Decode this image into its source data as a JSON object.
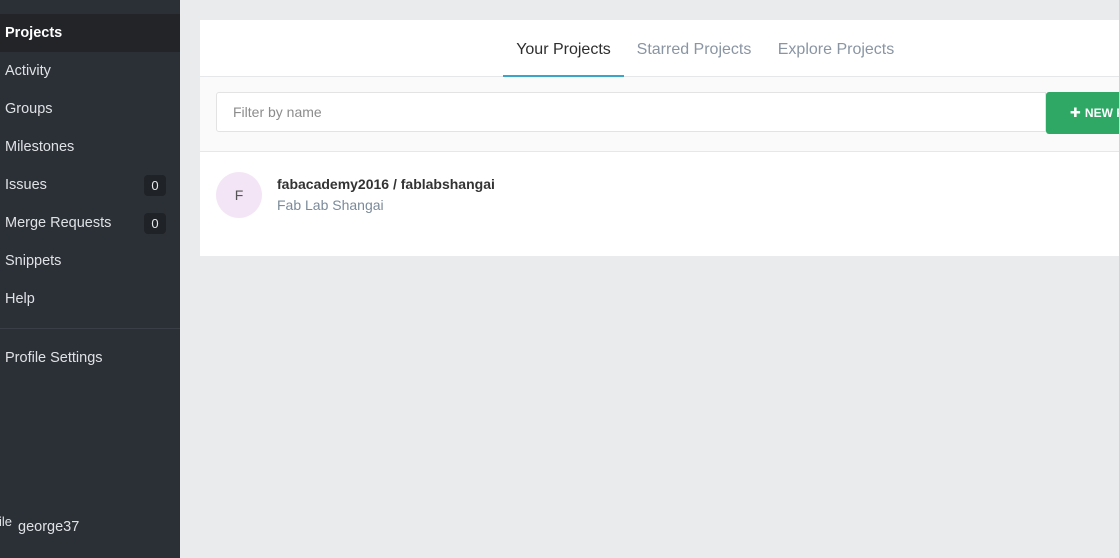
{
  "sidebar": {
    "items": [
      {
        "label": "Projects",
        "active": true
      },
      {
        "label": "Activity"
      },
      {
        "label": "Groups"
      },
      {
        "label": "Milestones"
      },
      {
        "label": "Issues",
        "badge": "0"
      },
      {
        "label": "Merge Requests",
        "badge": "0"
      },
      {
        "label": "Snippets"
      },
      {
        "label": "Help"
      }
    ],
    "profile_settings": "Profile Settings",
    "user": {
      "profile_fragment": "ile",
      "username": "george37"
    }
  },
  "tabs": [
    {
      "label": "Your Projects",
      "active": true
    },
    {
      "label": "Starred Projects"
    },
    {
      "label": "Explore Projects"
    }
  ],
  "filter": {
    "placeholder": "Filter by name",
    "value": ""
  },
  "new_button": {
    "label": "NEW P"
  },
  "projects": [
    {
      "avatar_letter": "F",
      "name": "fabacademy2016 / fablabshangai",
      "description": "Fab Lab Shangai"
    }
  ],
  "colors": {
    "sidebar_bg": "#2b2f36",
    "accent_tab": "#3aa4c9",
    "new_button": "#2fa866",
    "avatar_bg": "#f3e5f5"
  }
}
